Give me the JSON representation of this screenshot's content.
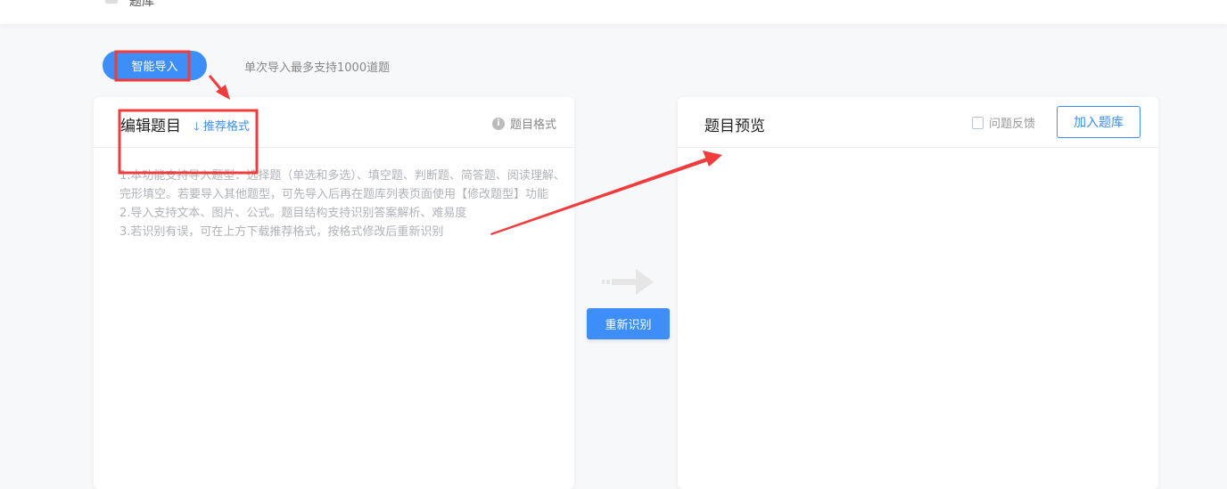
{
  "header": {
    "breadcrumb": "题库"
  },
  "toolbar": {
    "smart_import": "智能导入",
    "tip": "单次导入最多支持1000道题"
  },
  "editor": {
    "title": "编辑题目",
    "download_format": "推荐格式",
    "format_help": "题目格式",
    "instructions": [
      "1.本功能支持导入题型：选择题（单选和多选）、填空题、判断题、简答题、阅读理解、完形填空。若要导入其他题型，可先导入后再在题库列表页面使用【修改题型】功能",
      "2.导入支持文本、图片、公式。题目结构支持识别答案解析、难易度",
      "3.若识别有误，可在上方下载推荐格式，按格式修改后重新识别"
    ]
  },
  "middle": {
    "recognize_again": "重新识别"
  },
  "preview": {
    "title": "题目预览",
    "feedback": "问题反馈",
    "add_to_bank": "加入题库"
  },
  "colors": {
    "accent": "#3d8ef8",
    "annotation": "#f03c3c"
  }
}
